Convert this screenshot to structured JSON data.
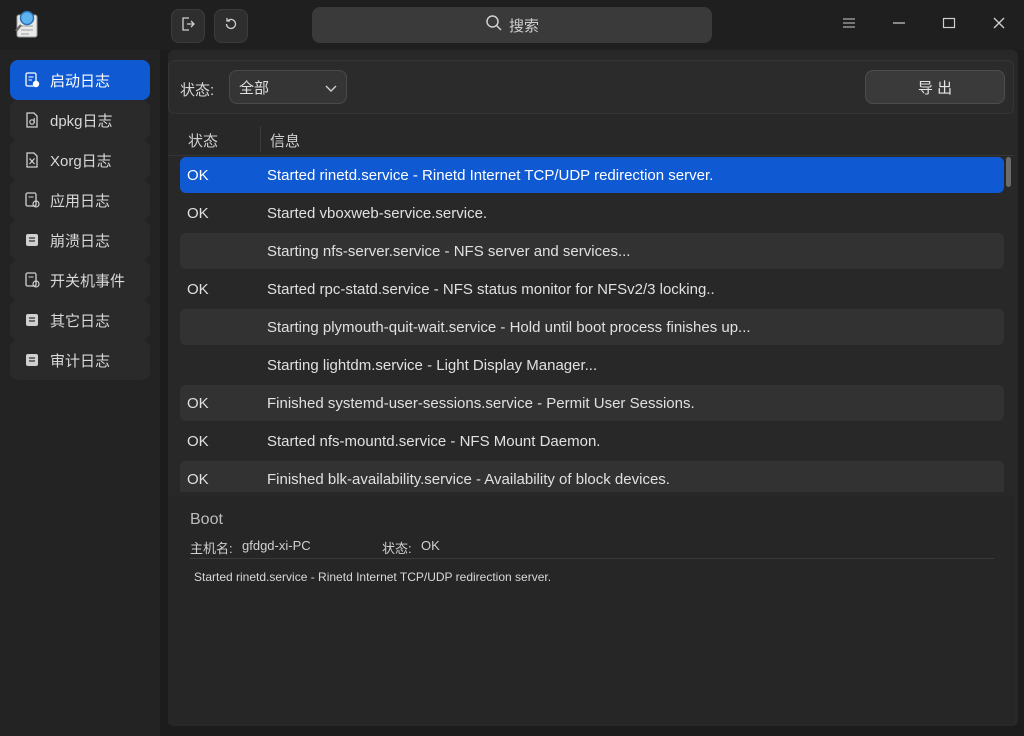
{
  "titlebar": {
    "search_label": "搜索",
    "icons": {
      "logo": "log-viewer-logo-icon",
      "export": "export-icon",
      "refresh": "refresh-icon",
      "search": "search-icon",
      "menu": "menu-icon",
      "minimize": "minimize-icon",
      "maximize": "maximize-icon",
      "close": "close-icon"
    }
  },
  "sidebar": {
    "items": [
      {
        "label": "启动日志",
        "icon": "boot-log-icon",
        "active": true
      },
      {
        "label": "dpkg日志",
        "icon": "dpkg-log-icon"
      },
      {
        "label": "Xorg日志",
        "icon": "xorg-log-icon"
      },
      {
        "label": "应用日志",
        "icon": "app-log-icon"
      },
      {
        "label": "崩溃日志",
        "icon": "crash-log-icon"
      },
      {
        "label": "开关机事件",
        "icon": "power-event-icon"
      },
      {
        "label": "其它日志",
        "icon": "other-log-icon"
      },
      {
        "label": "审计日志",
        "icon": "audit-log-icon"
      }
    ]
  },
  "filter": {
    "status_label": "状态:",
    "status_value": "全部",
    "export_label": "导 出"
  },
  "table": {
    "headers": {
      "status": "状态",
      "info": "信息"
    },
    "rows": [
      {
        "status": "OK",
        "info": "Started rinetd.service - Rinetd Internet TCP/UDP redirection server."
      },
      {
        "status": "OK",
        "info": "Started vboxweb-service.service."
      },
      {
        "status": "",
        "info": "Starting nfs-server.service - NFS server and services..."
      },
      {
        "status": "OK",
        "info": "Started rpc-statd.service - NFS status monitor for NFSv2/3 locking.."
      },
      {
        "status": "",
        "info": "Starting plymouth-quit-wait.service - Hold until boot process finishes up..."
      },
      {
        "status": "",
        "info": "Starting lightdm.service - Light Display Manager..."
      },
      {
        "status": "OK",
        "info": "Finished systemd-user-sessions.service - Permit User Sessions."
      },
      {
        "status": "OK",
        "info": "Started nfs-mountd.service - NFS Mount Daemon."
      },
      {
        "status": "OK",
        "info": "Finished blk-availability.service - Availability of block devices."
      }
    ]
  },
  "detail": {
    "title": "Boot",
    "host_label": "主机名:",
    "host_value": "gfdgd-xi-PC",
    "status_label": "状态:",
    "status_value": "OK",
    "message": "Started rinetd.service - Rinetd Internet TCP/UDP redirection server."
  },
  "colors": {
    "accent": "#0f5ad3",
    "background": "#1c1c1c",
    "panel": "#282828"
  }
}
